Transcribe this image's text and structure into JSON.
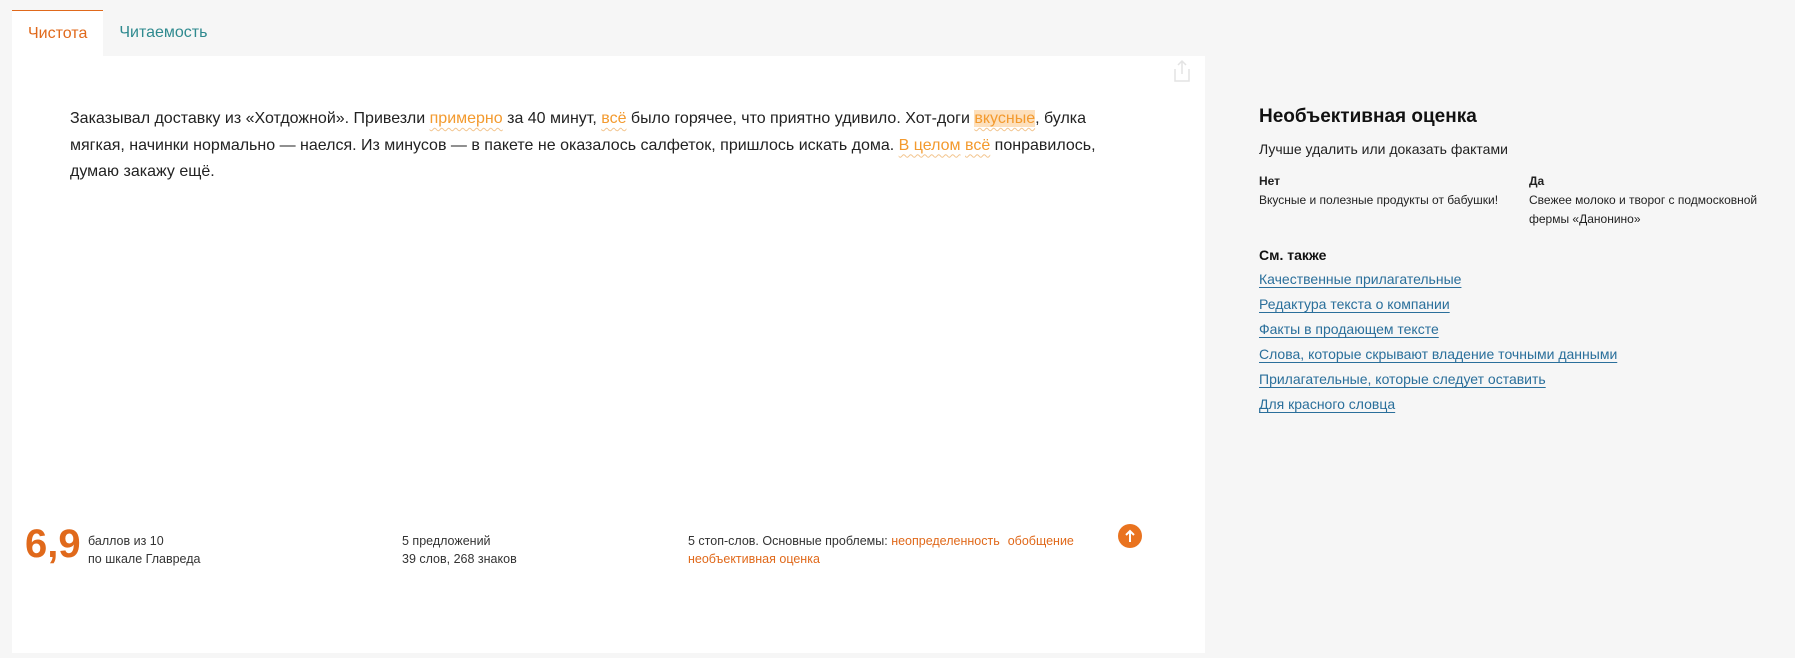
{
  "tabs": [
    {
      "label": "Чистота",
      "active": true
    },
    {
      "label": "Читаемость",
      "active": false
    }
  ],
  "editor": {
    "text": {
      "s1": "Заказывал доставку из «Хотдожной». Привезли ",
      "h1": "примерно",
      "s2": " за 40 минут, ",
      "h2": "всё",
      "s3": " было горячее, что приятно удивило. Хот-доги ",
      "h3": "вкусные",
      "s4": ", булка мягкая, начинки нормально — наелся. Из минусов — в пакете не оказалось салфеток, пришлось искать дома. ",
      "h4": "В целом",
      "s5": " ",
      "h5": "всё",
      "s6": " понравилось, думаю закажу ещё."
    }
  },
  "stats": {
    "score": "6,9",
    "score_line1": "баллов из 10",
    "score_line2": "по шкале Главреда",
    "sentences": "5 предложений",
    "words": "39 слов, 268 знаков",
    "stopwords_prefix": "5 стоп-слов. Основные проблемы: ",
    "problems": [
      "неопределенность",
      "обобщение",
      "необъективная оценка"
    ]
  },
  "sidebar": {
    "title": "Необъективная оценка",
    "subtitle": "Лучше удалить или доказать фактами",
    "no_label": "Нет",
    "no_example": "Вкусные и полезные продукты от бабушки!",
    "yes_label": "Да",
    "yes_example": "Свежее молоко и творог с подмосковной фермы «Данонино»",
    "see_also_title": "См. также",
    "links": [
      "Качественные прилагательные",
      "Редактура текста о компании",
      "Факты в продающем тексте",
      "Слова, которые скрывают владение точными данными",
      "Прилагательные, которые следует оставить",
      "Для красного словца"
    ]
  },
  "colors": {
    "accent": "#e0691b",
    "highlight": "#f39a2e",
    "link": "#2a6f9b",
    "tab_link": "#2f8a8f"
  },
  "icons": [
    "share-icon",
    "arrow-up-icon"
  ]
}
